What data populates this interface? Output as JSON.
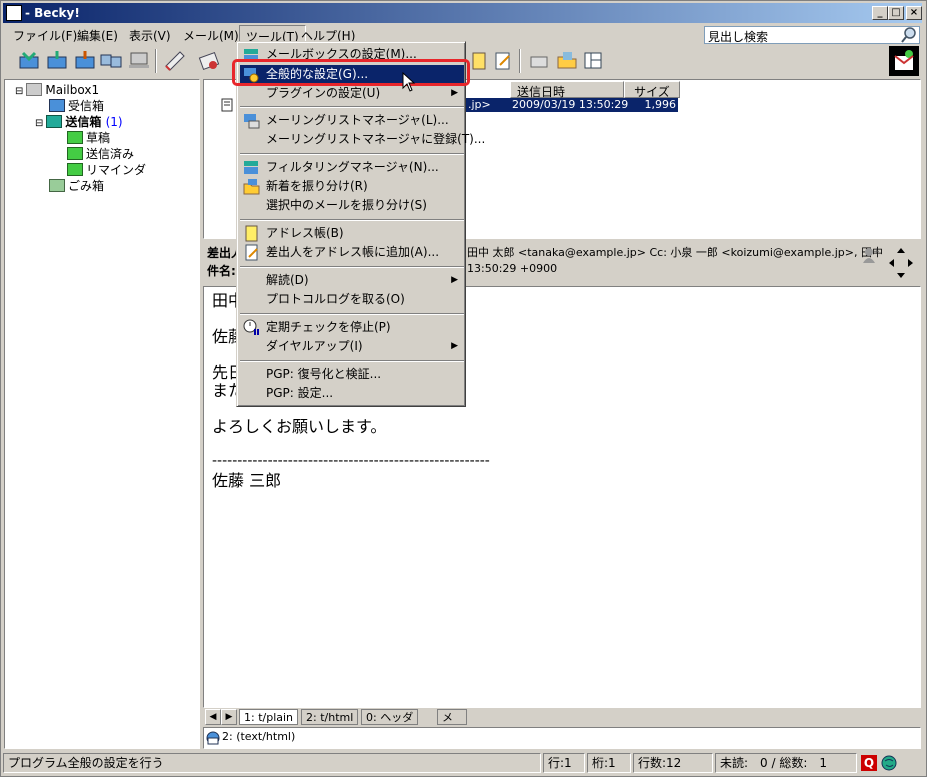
{
  "window": {
    "title": "- Becky!"
  },
  "menubar": {
    "items": [
      "ファイル(F)",
      "編集(E)",
      "表示(V)",
      "メール(M)",
      "ツール(T)",
      "ヘルプ(H)"
    ]
  },
  "search": {
    "placeholder": "見出し検索"
  },
  "tree": {
    "root": "Mailbox1",
    "inbox": "受信箱",
    "outbox": "送信箱",
    "outbox_count": "(1)",
    "drafts": "草稿",
    "sent": "送信済み",
    "reminder": "リマインダ",
    "trash": "ごみ箱"
  },
  "list": {
    "col_date": "送信日時",
    "col_size": "サイズ",
    "row_from_tail": ".jp>",
    "row_date": "2009/03/19 13:50:29",
    "row_size": "1,996"
  },
  "header": {
    "from_label": "差出人",
    "subject_label": "件名:",
    "from_value": "田中 太郎 <tanaka@example.jp>  Cc: 小泉 一郎 <koizumi@example.jp>, 田中",
    "date_value": "13:50:29 +0900"
  },
  "body": {
    "l1": "田中",
    "l2": "佐藤",
    "l3": "先日",
    "l4": "また",
    "l5": "よろしくお願いします。",
    "l6": "-------------------------------------------------------",
    "l7": "佐藤 三郎"
  },
  "tabs": {
    "t1": "1: t/plain",
    "t2": "2: t/html",
    "t3": "0: ヘッダ",
    "t4": "メモ"
  },
  "attach": {
    "label": "2: (text/html)"
  },
  "status": {
    "message": "プログラム全般の設定を行う",
    "row": "行:1",
    "col": "桁:1",
    "lines": "行数:12",
    "unread": "未読:　0 / 総数:　1"
  },
  "tools_menu": {
    "i1": "メールボックスの設定(M)...",
    "i2": "全般的な設定(G)...",
    "i3": "プラグインの設定(U)",
    "i4": "メーリングリストマネージャ(L)...",
    "i5": "メーリングリストマネージャに登録(T)...",
    "i6": "フィルタリングマネージャ(N)...",
    "i7": "新着を振り分け(R)",
    "i8": "選択中のメールを振り分け(S)",
    "i9": "アドレス帳(B)",
    "i10": "差出人をアドレス帳に追加(A)...",
    "i11": "解読(D)",
    "i12": "プロトコルログを取る(O)",
    "i13": "定期チェックを停止(P)",
    "i14": "ダイヤルアップ(I)",
    "i15": "PGP: 復号化と検証...",
    "i16": "PGP: 設定..."
  },
  "colors": {
    "highlight": "#0a246a",
    "annotation": "#e8262b",
    "face": "#d4d0c8"
  }
}
